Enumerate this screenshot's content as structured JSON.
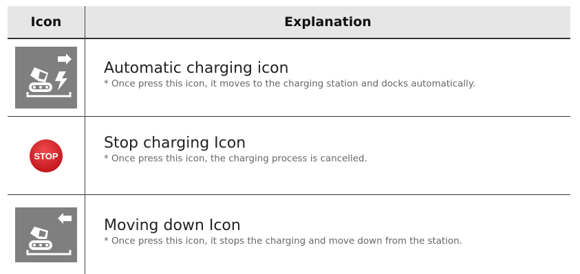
{
  "table": {
    "headers": {
      "icon": "Icon",
      "explanation": "Explanation"
    },
    "rows": [
      {
        "icon": "auto-charge-icon",
        "title": "Automatic charging icon",
        "note": "* Once press this icon, it moves to the charging station and docks automatically."
      },
      {
        "icon": "stop-icon",
        "icon_text": "STOP",
        "title": "Stop charging Icon",
        "note": "* Once press this icon, the charging process is cancelled."
      },
      {
        "icon": "move-down-icon",
        "title": "Moving down Icon",
        "note": "* Once press this icon, it stops the charging and move down from the station."
      }
    ]
  },
  "colors": {
    "header_bg": "#e6e6e6",
    "icon_bg": "#7f7f7f",
    "stop_red": "#d9262c"
  }
}
